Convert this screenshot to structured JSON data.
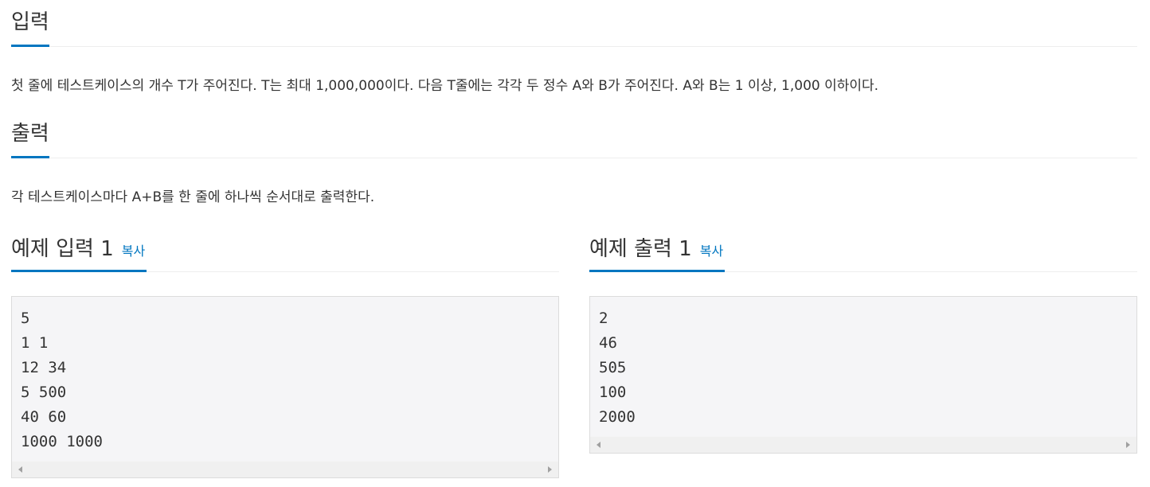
{
  "input_section": {
    "title": "입력",
    "description": "첫 줄에 테스트케이스의 개수 T가 주어진다. T는 최대 1,000,000이다. 다음 T줄에는 각각 두 정수 A와 B가 주어진다. A와 B는 1 이상, 1,000 이하이다."
  },
  "output_section": {
    "title": "출력",
    "description": "각 테스트케이스마다 A+B를 한 줄에 하나씩 순서대로 출력한다."
  },
  "sample_input": {
    "title": "예제 입력 1",
    "copy_label": "복사",
    "content": "5\n1 1\n12 34\n5 500\n40 60\n1000 1000"
  },
  "sample_output": {
    "title": "예제 출력 1",
    "copy_label": "복사",
    "content": "2\n46\n505\n100\n2000"
  },
  "colors": {
    "accent": "#0076c0",
    "code_background": "#f5f5f7",
    "text": "#333333"
  }
}
